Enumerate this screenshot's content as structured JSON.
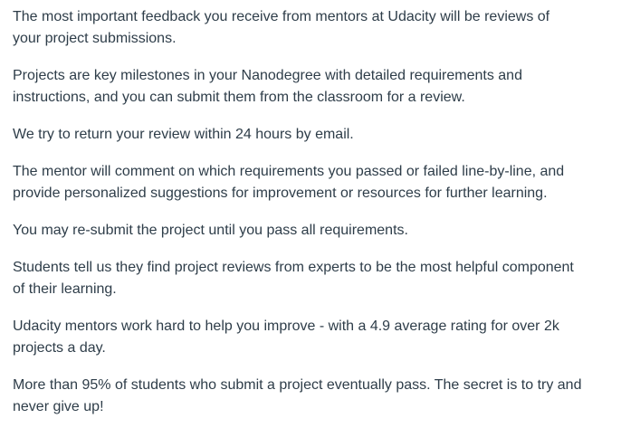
{
  "paragraphs": [
    "The most important feedback you receive from mentors at Udacity will be reviews of\nyour project submissions.",
    "Projects are key milestones in your Nanodegree with detailed requirements and\ninstructions, and you can submit them from the classroom for a review.",
    "We try to return your review within 24 hours by email.",
    "The mentor will comment on which requirements you passed or failed line-by-line, and\nprovide personalized suggestions for improvement or resources for further learning.",
    "You may re-submit the project until you pass all requirements.",
    "Students tell us they find project reviews from experts to be the most helpful component\nof their learning.",
    "Udacity mentors work hard to help you improve - with a 4.9 average rating for over 2k\nprojects a day.",
    "More than 95% of students who submit a project eventually pass. The secret is to try and\nnever give up!"
  ]
}
